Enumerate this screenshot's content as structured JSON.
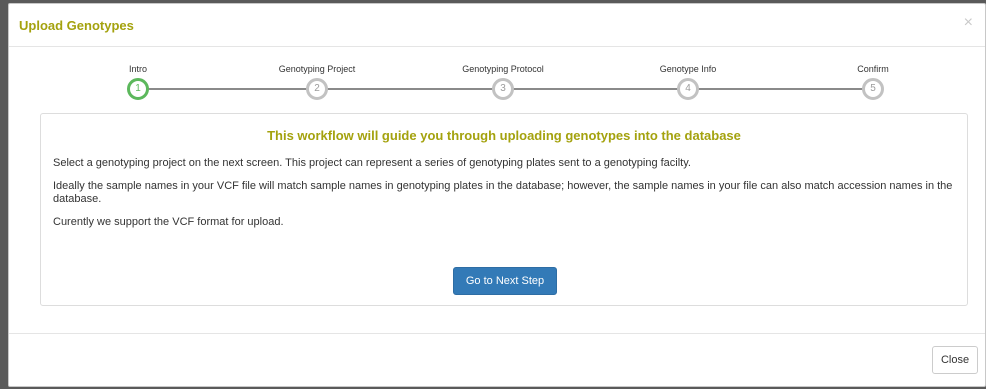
{
  "modal": {
    "title": "Upload Genotypes",
    "close_glyph": "×"
  },
  "steps": [
    {
      "label": "Intro",
      "number": "1",
      "active": true
    },
    {
      "label": "Genotyping Project",
      "number": "2",
      "active": false
    },
    {
      "label": "Genotyping Protocol",
      "number": "3",
      "active": false
    },
    {
      "label": "Genotype Info",
      "number": "4",
      "active": false
    },
    {
      "label": "Confirm",
      "number": "5",
      "active": false
    }
  ],
  "panel": {
    "heading": "This workflow will guide you through uploading genotypes into the database",
    "paragraphs": [
      "Select a genotyping project on the next screen. This project can represent a series of genotyping plates sent to a genotyping facilty.",
      "Ideally the sample names in your VCF file will match sample names in genotyping plates in the database; however, the sample names in your file can also match accession names in the database.",
      "Curently we support the VCF format for upload."
    ],
    "next_button": "Go to Next Step"
  },
  "footer": {
    "close_button": "Close"
  },
  "colors": {
    "title": "#a4a20e",
    "active_step": "#5cb85c",
    "inactive_step": "#c2c2c2",
    "primary_button": "#337ab7"
  }
}
